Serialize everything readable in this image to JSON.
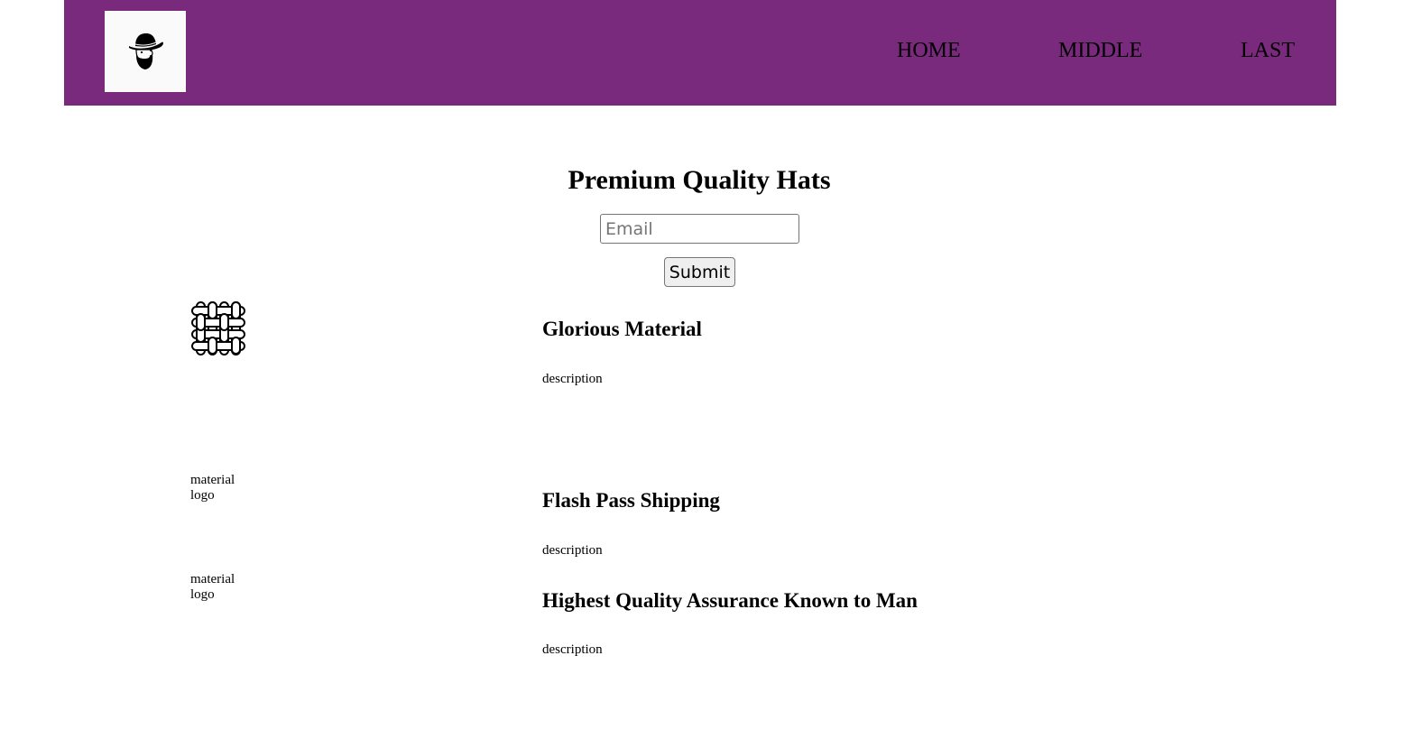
{
  "header": {
    "logo_icon": "bearded-man-with-hat-icon",
    "brand_color": "#792a7c",
    "nav": [
      {
        "label": "HOME"
      },
      {
        "label": "MIDDLE"
      },
      {
        "label": "LAST"
      }
    ]
  },
  "hero": {
    "title": "Premium Quality Hats",
    "email_placeholder": "Email",
    "submit_label": "Submit"
  },
  "features": [
    {
      "icon": "woven-fabric-icon",
      "icon_alt": "",
      "title": "Glorious Material",
      "description": "description"
    },
    {
      "icon": "broken-image",
      "icon_alt": "material logo",
      "title": "Flash Pass Shipping",
      "description": "description"
    },
    {
      "icon": "broken-image",
      "icon_alt": "material logo",
      "title": "Highest Quality Assurance Known to Man",
      "description": "description"
    }
  ]
}
